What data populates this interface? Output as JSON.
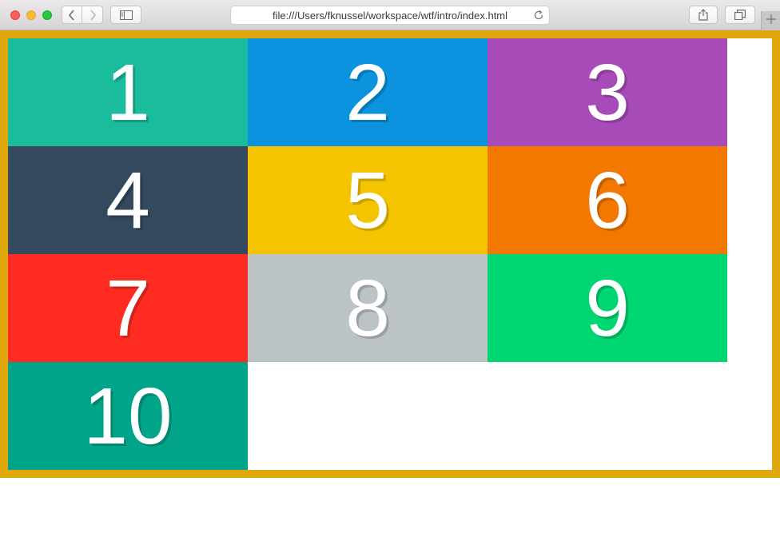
{
  "browser": {
    "address_url": "file:///Users/fknussel/workspace/wtf/intro/index.html",
    "icons": {
      "back": "chevron-left-icon",
      "forward": "chevron-right-icon",
      "sidebar": "sidebar-icon",
      "reload": "reload-icon",
      "share": "share-icon",
      "tabs": "tabs-overview-icon",
      "new_tab": "plus-icon"
    }
  },
  "page": {
    "container_border_color": "#e0a80d",
    "items": [
      {
        "label": "1",
        "color": "#1abc9c"
      },
      {
        "label": "2",
        "color": "#0b93df"
      },
      {
        "label": "3",
        "color": "#a64bb8"
      },
      {
        "label": "4",
        "color": "#34495e"
      },
      {
        "label": "5",
        "color": "#f4c400"
      },
      {
        "label": "6",
        "color": "#f37802"
      },
      {
        "label": "7",
        "color": "#fe2b21"
      },
      {
        "label": "8",
        "color": "#bcc3c6"
      },
      {
        "label": "9",
        "color": "#00d672"
      },
      {
        "label": "10",
        "color": "#00a489"
      }
    ]
  }
}
